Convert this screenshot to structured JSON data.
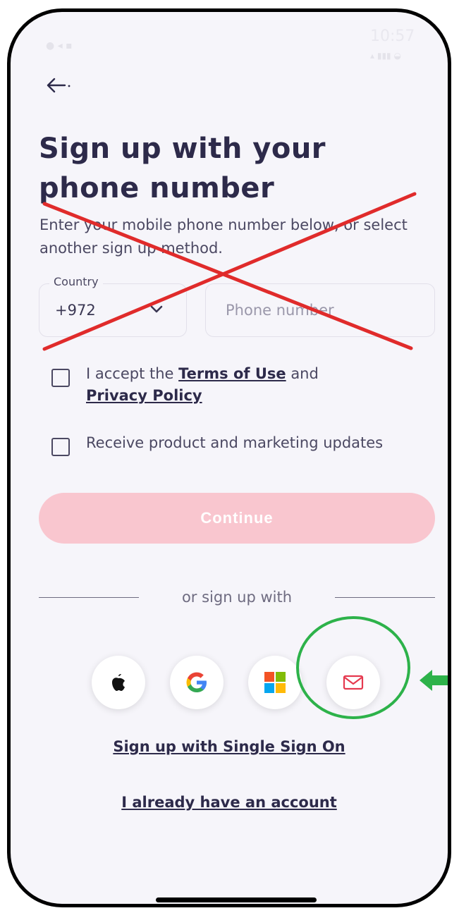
{
  "status_bar": {
    "time": "10:57"
  },
  "header": {
    "back_icon": "arrow-left-icon",
    "title": "Sign up with your phone number",
    "subtitle": "Enter your mobile phone number below, or select another sign up method."
  },
  "form": {
    "country_label": "Country",
    "country_value": "+972",
    "phone_placeholder": "Phone number",
    "terms_prefix": "I accept the ",
    "terms_link": "Terms of Use",
    "terms_mid": " and",
    "privacy_link": "Privacy Policy",
    "marketing_label": "Receive product and marketing updates",
    "continue_label": "Continue"
  },
  "alternatives": {
    "divider_text": "or sign up with",
    "providers": [
      {
        "name": "Apple",
        "icon": "apple-icon"
      },
      {
        "name": "Google",
        "icon": "google-icon"
      },
      {
        "name": "Microsoft",
        "icon": "microsoft-icon"
      },
      {
        "name": "Email",
        "icon": "mail-icon"
      }
    ],
    "sso_link": "Sign up with Single Sign On",
    "login_link": "I already have an account"
  },
  "annotations": {
    "cross_color": "#e02b2b",
    "highlight_color": "#2db24a"
  },
  "colors": {
    "primary_text": "#2d2a4a",
    "continue_bg": "#f9c6cf",
    "background": "#f6f5fa"
  }
}
